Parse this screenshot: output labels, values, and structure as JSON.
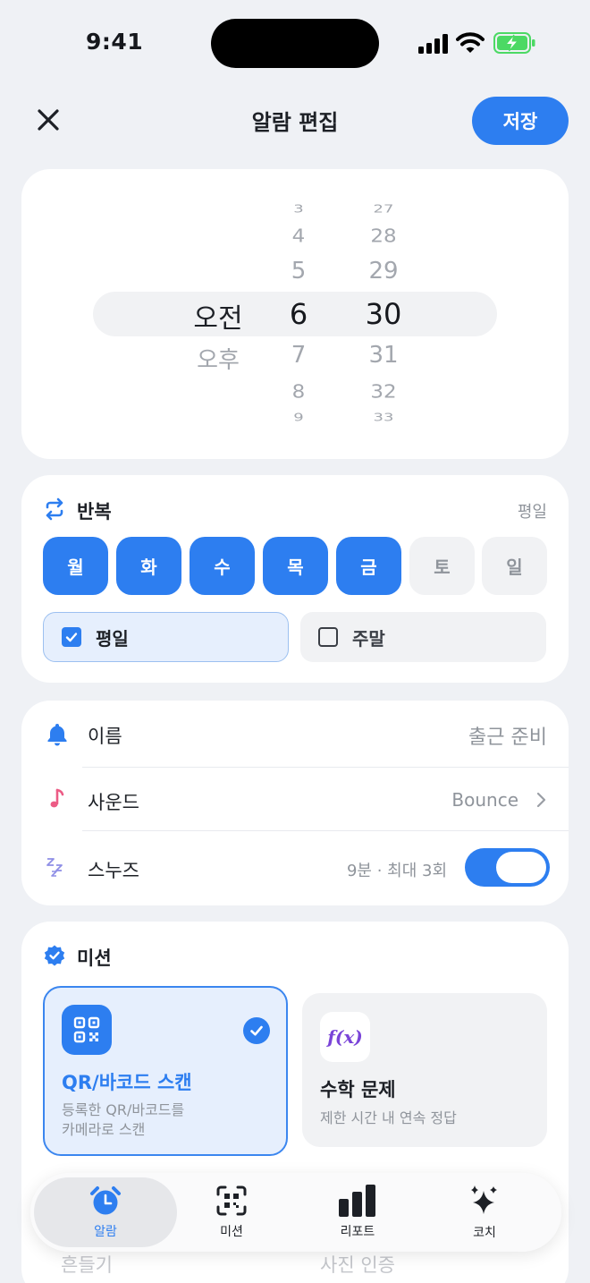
{
  "status_bar": {
    "time": "9:41"
  },
  "header": {
    "title": "알람 편집",
    "save_label": "저장"
  },
  "picker": {
    "ampm": [
      "오전",
      "오후"
    ],
    "hours": [
      "3",
      "4",
      "5",
      "6",
      "7",
      "8",
      "9"
    ],
    "minutes": [
      "27",
      "28",
      "29",
      "30",
      "31",
      "32",
      "33"
    ],
    "selected": {
      "ampm": "오전",
      "hour": "6",
      "minute": "30"
    }
  },
  "repeat": {
    "title": "반복",
    "summary": "평일",
    "days": [
      {
        "label": "월",
        "on": true
      },
      {
        "label": "화",
        "on": true
      },
      {
        "label": "수",
        "on": true
      },
      {
        "label": "목",
        "on": true
      },
      {
        "label": "금",
        "on": true
      },
      {
        "label": "토",
        "on": false
      },
      {
        "label": "일",
        "on": false
      }
    ],
    "presets": [
      {
        "label": "평일",
        "checked": true
      },
      {
        "label": "주말",
        "checked": false
      }
    ]
  },
  "settings": {
    "name": {
      "label": "이름",
      "value": "출근 준비"
    },
    "sound": {
      "label": "사운드",
      "value": "Bounce"
    },
    "snooze": {
      "label": "스누즈",
      "value": "9분 · 최대 3회",
      "enabled": true
    }
  },
  "mission": {
    "title": "미션",
    "options": [
      {
        "title": "QR/바코드 스캔",
        "desc1": "등록한 QR/바코드를",
        "desc2": "카메라로 스캔",
        "selected": true
      },
      {
        "title": "수학 문제",
        "desc1": "제한 시간 내 연속 정답",
        "icon_text": "f(x)",
        "selected": false
      }
    ],
    "hidden_options": [
      "흔들기",
      "사진 인증"
    ]
  },
  "tabbar": {
    "tabs": [
      {
        "label": "알람",
        "icon": "alarm-clock-icon",
        "active": true
      },
      {
        "label": "미션",
        "icon": "qr-scan-icon",
        "active": false
      },
      {
        "label": "리포트",
        "icon": "bar-chart-icon",
        "active": false
      },
      {
        "label": "코치",
        "icon": "sparkle-icon",
        "active": false
      }
    ]
  },
  "colors": {
    "accent": "#2d7ef0",
    "sound_icon": "#ec5b85",
    "snooze_icon": "#8e8ee6",
    "math_icon": "#7a44d8"
  }
}
